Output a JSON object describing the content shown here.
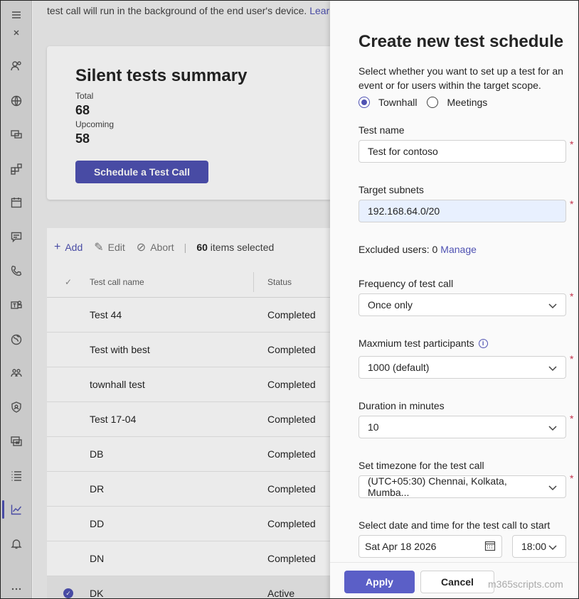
{
  "rail": {
    "icons": [
      "menu-icon",
      "collapse-icon",
      "users-icon",
      "globe-icon",
      "devices-icon",
      "apps-icon",
      "calendar-icon",
      "chat-icon",
      "phone-icon",
      "teams-icon",
      "locations-icon",
      "org-icon",
      "security-icon",
      "meeting-room-icon",
      "list-icon",
      "analytics-icon",
      "bell-icon",
      "more-icon"
    ]
  },
  "main": {
    "topline_text": "test call will run in the background of the end user's device.",
    "topline_link": "Learn",
    "summary": {
      "title": "Silent tests summary",
      "total_label": "Total",
      "total_value": "68",
      "upcoming_label": "Upcoming",
      "upcoming_value": "58",
      "schedule_button": "Schedule a Test Call"
    },
    "toolbar": {
      "add": "Add",
      "edit": "Edit",
      "abort": "Abort",
      "selected_count": "60",
      "selected_suffix": "items selected"
    },
    "table": {
      "headers": [
        "Test call name",
        "Status"
      ],
      "rows": [
        {
          "name": "Test 44",
          "status": "Completed"
        },
        {
          "name": "Test with best",
          "status": "Completed"
        },
        {
          "name": "townhall test",
          "status": "Completed"
        },
        {
          "name": "Test 17-04",
          "status": "Completed"
        },
        {
          "name": "DB",
          "status": "Completed"
        },
        {
          "name": "DR",
          "status": "Completed"
        },
        {
          "name": "DD",
          "status": "Completed"
        },
        {
          "name": "DN",
          "status": "Completed"
        },
        {
          "name": "DK",
          "status": "Active"
        }
      ]
    }
  },
  "panel": {
    "title": "Create new test schedule",
    "description": "Select whether you want to set up a test for an event or for users within the target scope.",
    "radios": [
      {
        "label": "Townhall",
        "checked": true
      },
      {
        "label": "Meetings",
        "checked": false
      }
    ],
    "test_name_label": "Test name",
    "test_name_value": "Test for contoso",
    "target_subnets_label": "Target subnets",
    "target_subnets_value": "192.168.64.0/20",
    "excluded_text": "Excluded users: 0",
    "excluded_link": "Manage",
    "frequency_label": "Frequency of test call",
    "frequency_value": "Once only",
    "participants_label": "Maxmium test participants",
    "participants_value": "1000 (default)",
    "duration_label": "Duration in minutes",
    "duration_value": "10",
    "timezone_label": "Set timezone for the test call",
    "timezone_value": "(UTC+05:30) Chennai, Kolkata, Mumba...",
    "datetime_label": "Select date and time for the test call to start",
    "date_value": "Sat Apr 18 2026",
    "time_value": "18:00",
    "required_mark": "*",
    "apply": "Apply",
    "cancel": "Cancel",
    "watermark": "m365scripts.com",
    "accent_color": "#5b5fc7"
  }
}
